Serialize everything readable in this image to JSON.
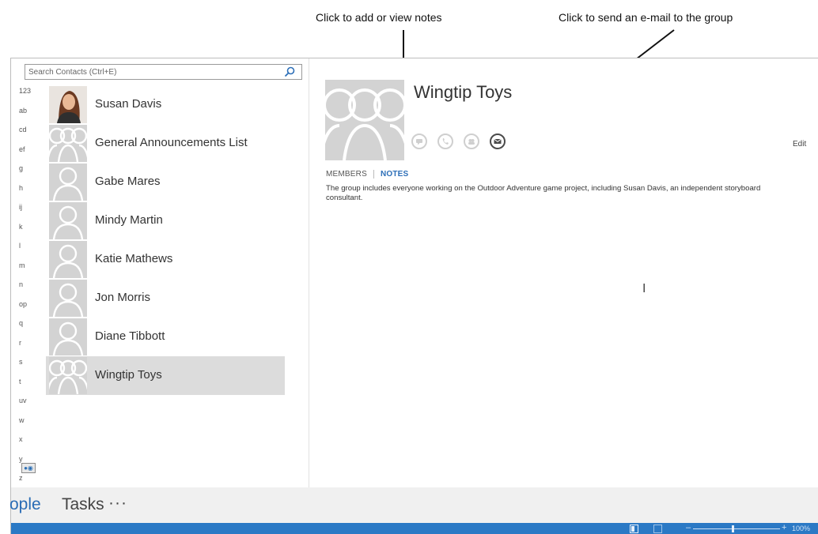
{
  "callouts": {
    "notes": "Click to add or view notes",
    "email": "Click to send an e-mail to the group"
  },
  "search": {
    "placeholder": "Search Contacts (Ctrl+E)",
    "icon": "search-icon"
  },
  "alpha_index": [
    "123",
    "ab",
    "cd",
    "ef",
    "g",
    "h",
    "ij",
    "k",
    "l",
    "m",
    "n",
    "op",
    "q",
    "r",
    "s",
    "t",
    "uv",
    "w",
    "x",
    "y",
    "z"
  ],
  "contacts": [
    {
      "name": "Susan Davis",
      "photo": "person-photo"
    },
    {
      "name": "General Announcements List",
      "photo": "group-placeholder"
    },
    {
      "name": "Gabe Mares",
      "photo": "person-placeholder"
    },
    {
      "name": "Mindy Martin",
      "photo": "person-placeholder"
    },
    {
      "name": "Katie Mathews",
      "photo": "person-placeholder"
    },
    {
      "name": "Jon Morris",
      "photo": "person-placeholder"
    },
    {
      "name": "Diane Tibbott",
      "photo": "person-placeholder"
    },
    {
      "name": "Wingtip Toys",
      "photo": "group-placeholder",
      "selected": true
    }
  ],
  "detail": {
    "name": "Wingtip Toys",
    "tabs": {
      "members": "MEMBERS",
      "notes": "NOTES",
      "active": "notes"
    },
    "notes": "The group includes everyone working on the Outdoor Adventure game project, including Susan Davis, an independent storyboard consultant.",
    "edit": "Edit",
    "actions": [
      "im-icon",
      "call-icon",
      "meeting-icon",
      "email-icon"
    ]
  },
  "nav": {
    "people": "ople",
    "tasks": "Tasks",
    "more": "···"
  },
  "status": {
    "zoom": "100%"
  },
  "colors": {
    "accent": "#2b79c5",
    "link": "#2d6fb8",
    "selection": "#dcdcdc"
  }
}
